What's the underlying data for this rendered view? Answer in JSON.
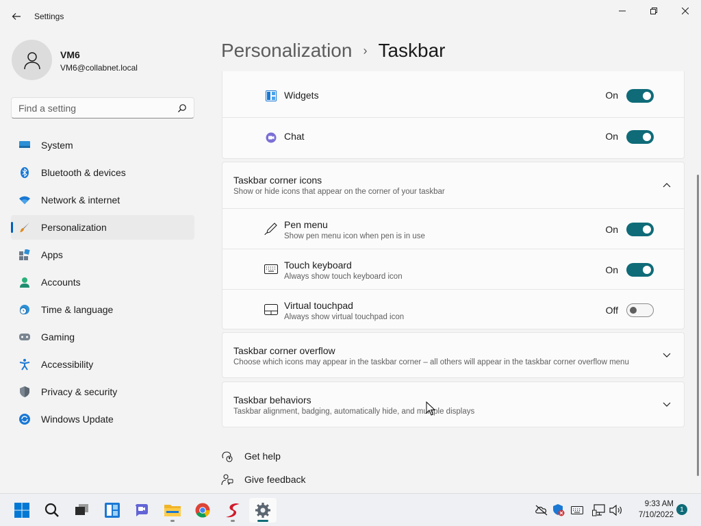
{
  "window": {
    "title": "Settings",
    "controls": [
      "minimize",
      "maximize",
      "close"
    ]
  },
  "user": {
    "name": "VM6",
    "email": "VM6@collabnet.local"
  },
  "search": {
    "placeholder": "Find a setting"
  },
  "sidebar": {
    "items": [
      {
        "label": "System",
        "icon": "monitor-icon"
      },
      {
        "label": "Bluetooth & devices",
        "icon": "bluetooth-icon"
      },
      {
        "label": "Network & internet",
        "icon": "wifi-icon"
      },
      {
        "label": "Personalization",
        "icon": "brush-icon",
        "active": true
      },
      {
        "label": "Apps",
        "icon": "apps-icon"
      },
      {
        "label": "Accounts",
        "icon": "person-icon"
      },
      {
        "label": "Time & language",
        "icon": "clock-globe-icon"
      },
      {
        "label": "Gaming",
        "icon": "gamepad-icon"
      },
      {
        "label": "Accessibility",
        "icon": "accessibility-icon"
      },
      {
        "label": "Privacy & security",
        "icon": "shield-icon"
      },
      {
        "label": "Windows Update",
        "icon": "update-icon"
      }
    ]
  },
  "header": {
    "parent": "Personalization",
    "separator": "›",
    "current": "Taskbar"
  },
  "taskbar_items": [
    {
      "title": "Widgets",
      "state": "On",
      "on": true
    },
    {
      "title": "Chat",
      "state": "On",
      "on": true
    }
  ],
  "corner_icons": {
    "title": "Taskbar corner icons",
    "description": "Show or hide icons that appear on the corner of your taskbar",
    "expanded": true,
    "items": [
      {
        "title": "Pen menu",
        "description": "Show pen menu icon when pen is in use",
        "state": "On",
        "on": true
      },
      {
        "title": "Touch keyboard",
        "description": "Always show touch keyboard icon",
        "state": "On",
        "on": true
      },
      {
        "title": "Virtual touchpad",
        "description": "Always show virtual touchpad icon",
        "state": "Off",
        "on": false
      }
    ]
  },
  "corner_overflow": {
    "title": "Taskbar corner overflow",
    "description": "Choose which icons may appear in the taskbar corner – all others will appear in the taskbar corner overflow menu"
  },
  "behaviors": {
    "title": "Taskbar behaviors",
    "description": "Taskbar alignment, badging, automatically hide, and multiple displays"
  },
  "links": {
    "help": "Get help",
    "feedback": "Give feedback"
  },
  "system_taskbar": {
    "apps": [
      "start-icon",
      "search-icon",
      "task-view-icon",
      "widgets-icon",
      "chat-icon",
      "file-explorer-icon",
      "chrome-icon",
      "app-icon",
      "settings-icon"
    ],
    "clock_time": "9:33 AM",
    "clock_date": "7/10/2022",
    "notification_count": "1"
  },
  "colors": {
    "accent": "#0f6b78",
    "selection_bar": "#005fb8"
  }
}
